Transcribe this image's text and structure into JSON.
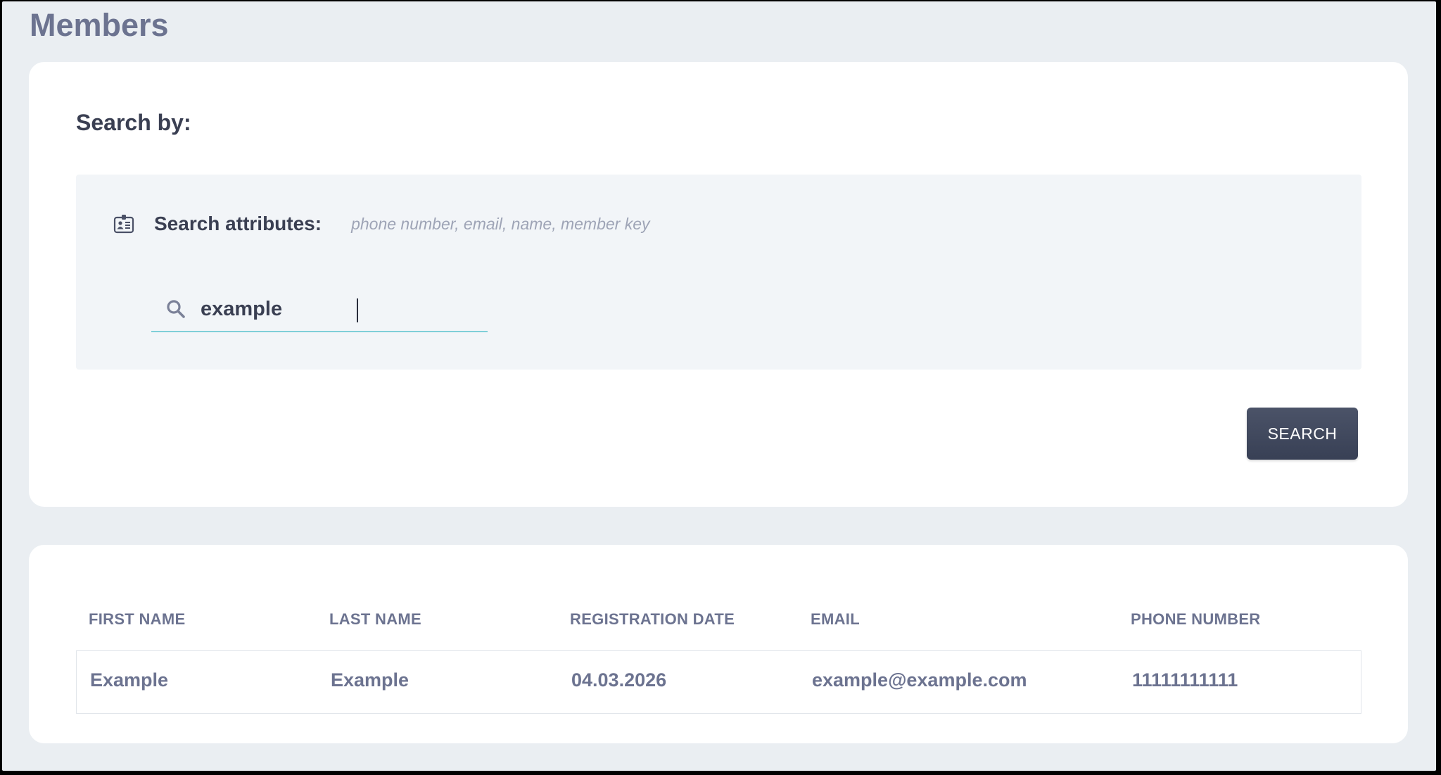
{
  "page": {
    "title": "Members"
  },
  "search": {
    "section_title": "Search by:",
    "attributes_label": "Search attributes:",
    "attributes_hint": "phone number, email, name, member key",
    "input_value": "example",
    "button_label": "SEARCH"
  },
  "icons": {
    "attributes": "id-badge-icon",
    "search": "search-icon"
  },
  "table": {
    "columns": [
      "FIRST NAME",
      "LAST NAME",
      "REGISTRATION DATE",
      "EMAIL",
      "PHONE NUMBER"
    ],
    "rows": [
      [
        "Example",
        "Example",
        "04.03.2026",
        "example@example.com",
        "11111111111"
      ]
    ]
  },
  "colors": {
    "background": "#eaeef2",
    "card": "#ffffff",
    "accent_underline": "#7fcfd8",
    "button": "#3f475c",
    "title_text": "#6c7390"
  }
}
